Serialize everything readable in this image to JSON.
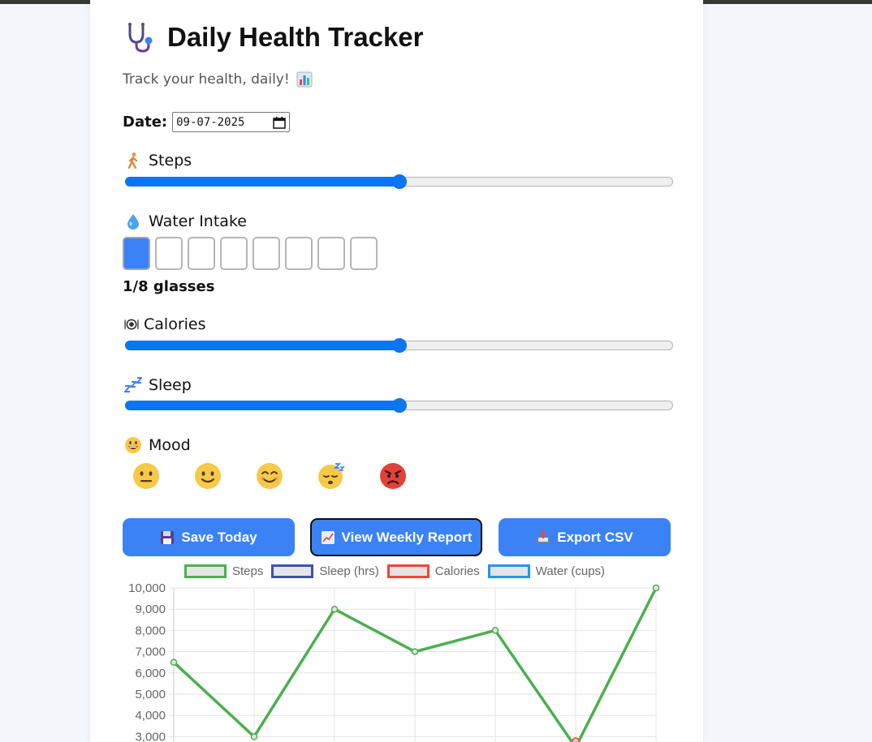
{
  "app": {
    "title": "Daily Health Tracker",
    "subtitle": "Track your health, daily!"
  },
  "date": {
    "label": "Date:",
    "value": "09-07-2025"
  },
  "fields": {
    "steps": {
      "label": "Steps",
      "value_fraction": 0.5
    },
    "water": {
      "label": "Water Intake",
      "filled": 1,
      "total": 8,
      "count_text": "1/8 glasses"
    },
    "calories": {
      "label": "Calories",
      "value_fraction": 0.5
    },
    "sleep": {
      "label": "Sleep",
      "value_fraction": 0.5
    },
    "mood": {
      "label": "Mood",
      "options": [
        "neutral-face",
        "slightly-smiling-face",
        "smiling-face",
        "sleeping-face",
        "angry-face"
      ]
    }
  },
  "buttons": {
    "save": "Save Today",
    "report": "View Weekly Report",
    "export": "Export CSV"
  },
  "colors": {
    "accent": "#3b82f6",
    "slider": "#0b75f3"
  },
  "chart_data": {
    "type": "line",
    "legend": [
      {
        "name": "Steps",
        "color": "#4caf50"
      },
      {
        "name": "Sleep (hrs)",
        "color": "#3f51b5"
      },
      {
        "name": "Calories",
        "color": "#f44336"
      },
      {
        "name": "Water (cups)",
        "color": "#2196f3"
      }
    ],
    "yticks": [
      "10,000",
      "9,000",
      "8,000",
      "7,000",
      "6,000",
      "5,000",
      "4,000",
      "3,000"
    ],
    "ylim": [
      3000,
      10000
    ],
    "series": [
      {
        "name": "Steps",
        "values": [
          6500,
          3000,
          9000,
          7000,
          8000,
          2500,
          10000
        ]
      }
    ],
    "grid": true
  }
}
